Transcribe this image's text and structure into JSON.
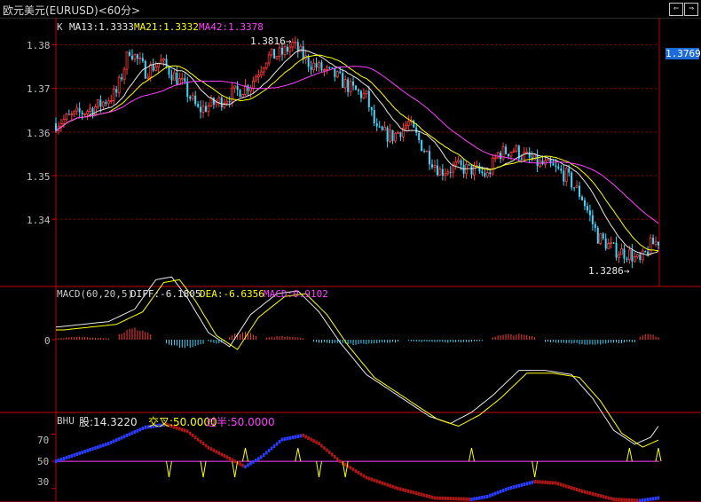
{
  "window": {
    "title": "欧元美元(EURUSD)<60分>",
    "prev_icon": "⇐",
    "next_icon": "⇒"
  },
  "colors": {
    "up": "#ff3c3c",
    "down": "#38d8ff",
    "ma13": "#e8e8e8",
    "ma21": "#ffff00",
    "ma42": "#ff40ff",
    "grid": "#a00000",
    "axis": "#c00000"
  },
  "price_panel": {
    "indicator": "K",
    "ma13_label": "MA13:1.3333",
    "ma21_label": "MA21:1.3332",
    "ma42_label": "MA42:1.3378",
    "y_ticks": [
      "1.38",
      "1.37",
      "1.36",
      "1.35",
      "1.34"
    ],
    "high_label": "1.3816→",
    "low_label": "1.3286→",
    "current_price": "1.3769"
  },
  "macd_panel": {
    "name": "MACD(60,20,5)",
    "diff": "DIFF:-6.1805",
    "dea": "DEA:-6.6356",
    "macd": "MACD:0.9102",
    "zero_tick": "0"
  },
  "bhu_panel": {
    "name": "BHU",
    "gu": "股:14.3220",
    "jiaocha": "交叉:50.0000",
    "guoban": "过半:50.0000",
    "y_ticks": [
      "70",
      "50",
      "30"
    ]
  },
  "chart_data": [
    {
      "type": "candlestick",
      "title": "欧元美元(EURUSD)<60分>",
      "ylim": [
        1.326,
        1.385
      ],
      "y_ticks": [
        1.38,
        1.37,
        1.36,
        1.35,
        1.34
      ],
      "anchors": [
        [
          0,
          1.362
        ],
        [
          8,
          1.364
        ],
        [
          16,
          1.366
        ],
        [
          23,
          1.369
        ],
        [
          28,
          1.379
        ],
        [
          34,
          1.374
        ],
        [
          40,
          1.376
        ],
        [
          48,
          1.371
        ],
        [
          54,
          1.365
        ],
        [
          62,
          1.367
        ],
        [
          68,
          1.369
        ],
        [
          74,
          1.371
        ],
        [
          80,
          1.377
        ],
        [
          86,
          1.378
        ],
        [
          90,
          1.38
        ],
        [
          96,
          1.376
        ],
        [
          102,
          1.374
        ],
        [
          106,
          1.373
        ],
        [
          112,
          1.37
        ],
        [
          118,
          1.368
        ],
        [
          122,
          1.36
        ],
        [
          128,
          1.359
        ],
        [
          134,
          1.362
        ],
        [
          140,
          1.356
        ],
        [
          146,
          1.351
        ],
        [
          152,
          1.352
        ],
        [
          160,
          1.351
        ],
        [
          164,
          1.35
        ],
        [
          168,
          1.355
        ],
        [
          174,
          1.356
        ],
        [
          182,
          1.353
        ],
        [
          188,
          1.352
        ],
        [
          194,
          1.35
        ],
        [
          200,
          1.345
        ],
        [
          206,
          1.336
        ],
        [
          212,
          1.333
        ],
        [
          218,
          1.332
        ],
        [
          222,
          1.33
        ],
        [
          226,
          1.334
        ],
        [
          229,
          1.335
        ]
      ],
      "series": [
        {
          "name": "MA13",
          "values": "MA13:1.3333"
        },
        {
          "name": "MA21",
          "values": "MA21:1.3332"
        },
        {
          "name": "MA42",
          "values": "MA42:1.3378"
        }
      ],
      "annotations": [
        "1.3816",
        "1.3286"
      ]
    },
    {
      "type": "line",
      "name": "MACD(60,20,5)",
      "diff_anchors": [
        [
          0,
          9
        ],
        [
          20,
          13
        ],
        [
          30,
          22
        ],
        [
          38,
          43
        ],
        [
          44,
          45
        ],
        [
          50,
          30
        ],
        [
          58,
          5
        ],
        [
          66,
          -5
        ],
        [
          74,
          18
        ],
        [
          84,
          33
        ],
        [
          92,
          35
        ],
        [
          100,
          20
        ],
        [
          108,
          -2
        ],
        [
          118,
          -25
        ],
        [
          130,
          -40
        ],
        [
          142,
          -55
        ],
        [
          150,
          -60
        ],
        [
          158,
          -52
        ],
        [
          166,
          -40
        ],
        [
          176,
          -22
        ],
        [
          186,
          -22
        ],
        [
          196,
          -25
        ],
        [
          204,
          -42
        ],
        [
          212,
          -65
        ],
        [
          220,
          -75
        ],
        [
          226,
          -70
        ],
        [
          229,
          -62
        ]
      ],
      "dea_offset": -2,
      "histogram_segments": [
        [
          0,
          20,
          3
        ],
        [
          24,
          36,
          12
        ],
        [
          42,
          56,
          -8
        ],
        [
          58,
          64,
          -4
        ],
        [
          66,
          76,
          8
        ],
        [
          80,
          94,
          4
        ],
        [
          98,
          130,
          -5
        ],
        [
          134,
          162,
          -3
        ],
        [
          166,
          182,
          6
        ],
        [
          186,
          220,
          -5
        ],
        [
          222,
          229,
          6
        ]
      ]
    },
    {
      "type": "line",
      "name": "BHU",
      "ylim": [
        22,
        82
      ],
      "y_ticks": [
        70,
        50,
        30
      ],
      "ref_line": 50,
      "anchors": [
        [
          0,
          50
        ],
        [
          20,
          63
        ],
        [
          34,
          75
        ],
        [
          42,
          77
        ],
        [
          50,
          72
        ],
        [
          58,
          60
        ],
        [
          66,
          52
        ],
        [
          72,
          46
        ],
        [
          78,
          53
        ],
        [
          86,
          66
        ],
        [
          94,
          69
        ],
        [
          100,
          63
        ],
        [
          108,
          50
        ],
        [
          118,
          38
        ],
        [
          130,
          30
        ],
        [
          144,
          23
        ],
        [
          158,
          22
        ],
        [
          164,
          24
        ],
        [
          172,
          30
        ],
        [
          182,
          35
        ],
        [
          190,
          34
        ],
        [
          200,
          28
        ],
        [
          212,
          22
        ],
        [
          222,
          21
        ],
        [
          229,
          23
        ]
      ],
      "spikes_up": [
        72,
        92,
        158,
        218,
        230
      ],
      "spikes_down": [
        43,
        56,
        68,
        100,
        110,
        182
      ]
    }
  ]
}
